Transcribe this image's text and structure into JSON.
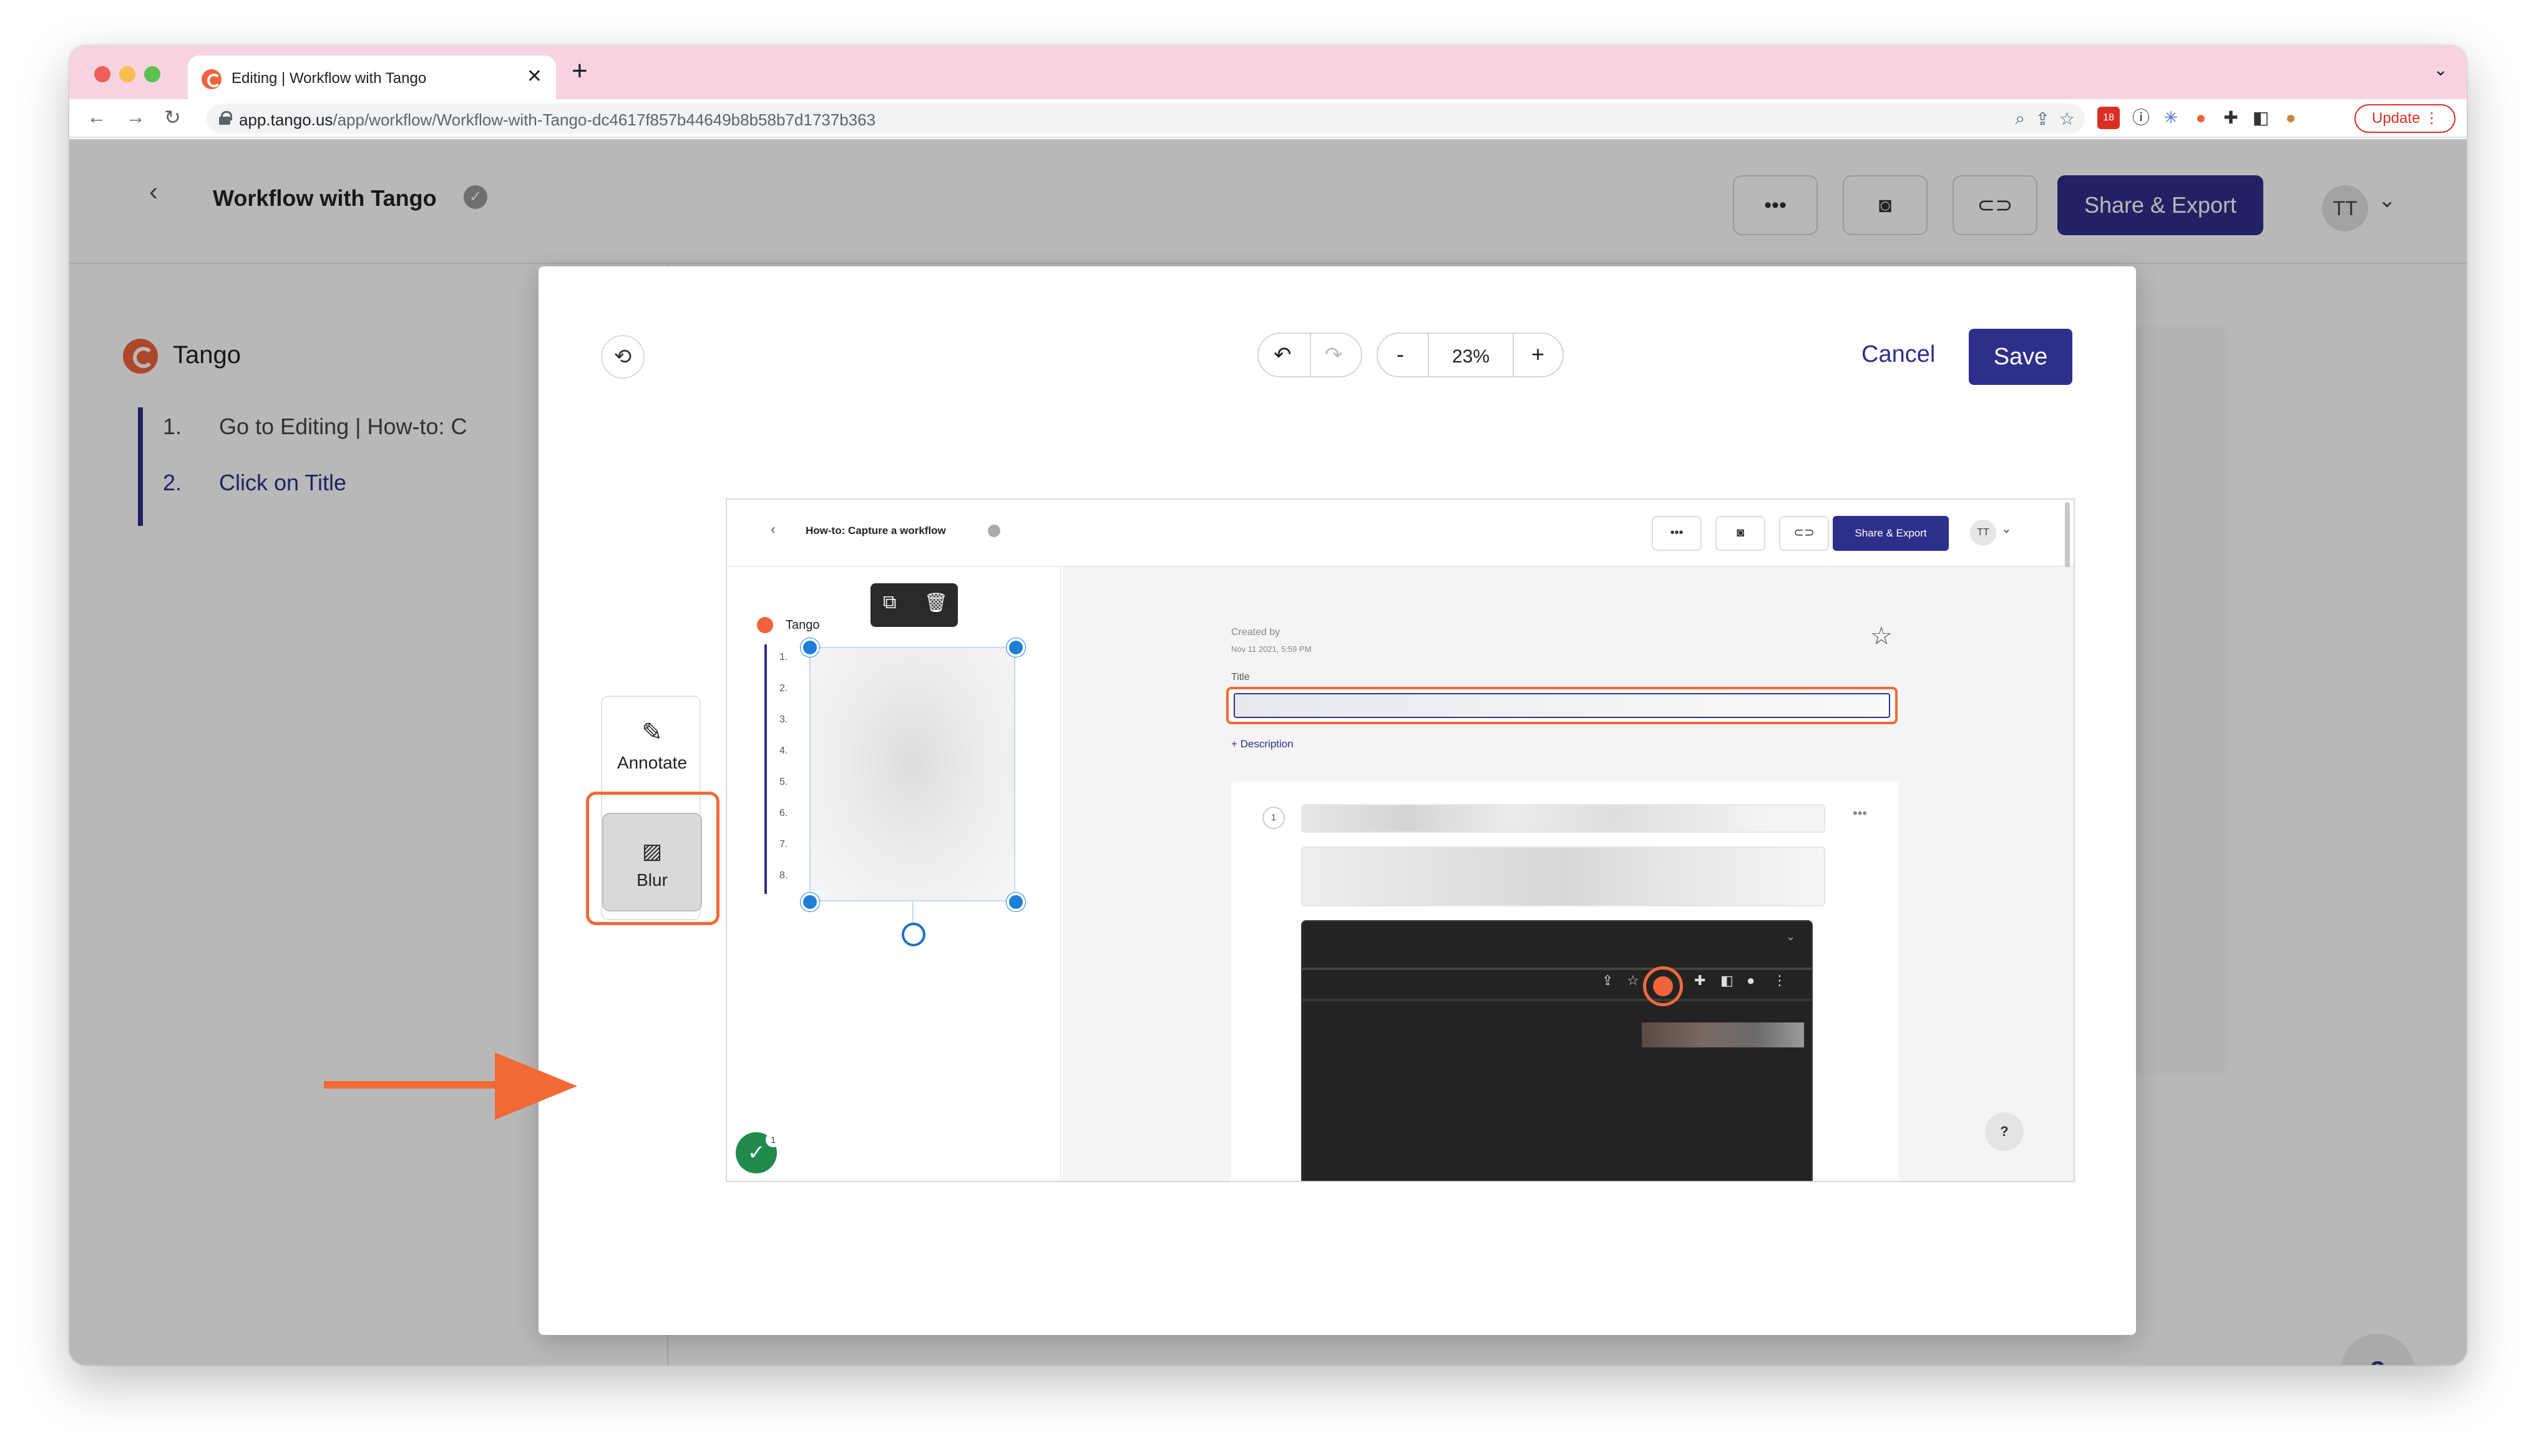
{
  "browser": {
    "tab_title": "Editing | Workflow with Tango",
    "tab_close": "✕",
    "new_tab": "+",
    "url_domain": "app.tango.us",
    "url_path": "/app/workflow/Workflow-with-Tango-dc4617f857b44649b8b58b7d1737b363",
    "update_label": "Update",
    "ext_badge_count": "18"
  },
  "page": {
    "title": "Workflow with Tango",
    "share_export": "Share & Export",
    "avatar_initials": "TT",
    "sidebar": {
      "brand": "Tango",
      "steps": [
        {
          "num": "1.",
          "label": "Go to Editing | How-to: C"
        },
        {
          "num": "2.",
          "label": "Click on Title"
        }
      ]
    },
    "help": "?"
  },
  "editor": {
    "zoom": "23%",
    "zoom_minus": "-",
    "zoom_plus": "+",
    "cancel": "Cancel",
    "save": "Save",
    "tools": [
      {
        "icon": "pencil-icon",
        "label": "Annotate"
      },
      {
        "icon": "blur-icon",
        "label": "Blur"
      }
    ],
    "selected_tool": "Blur",
    "colors": {
      "brand": "#2e2f8a",
      "highlight": "#f16a38"
    }
  },
  "screenshot": {
    "title": "How-to: Capture a workflow",
    "share_export": "Share & Export",
    "avatar_initials": "TT",
    "brand": "Tango",
    "step_numbers": [
      "1.",
      "2.",
      "3.",
      "4.",
      "5.",
      "6.",
      "7.",
      "8."
    ],
    "created_by": "Created by",
    "date": "Nov 11 2021, 5:59 PM",
    "title_label": "Title",
    "description_link": "+ Description",
    "step_number": "1",
    "check_badge": "1",
    "help": "?"
  }
}
